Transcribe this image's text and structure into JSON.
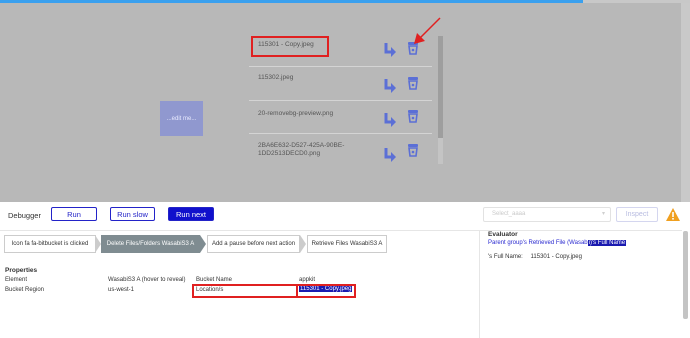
{
  "canvas": {
    "edit_button": "...edit me...",
    "files": [
      {
        "name": "115301 - Copy.jpeg"
      },
      {
        "name": "115302.jpeg"
      },
      {
        "name": "20-removebg-preview.png"
      },
      {
        "name": "2BA6E632-D527-425A-90BE-\n1DD2513DECD0.png"
      }
    ],
    "icons": {
      "move": "arrow-down-right-icon",
      "delete": "trash-icon",
      "warning": "warning-triangle-icon"
    },
    "colors": {
      "icon": "#5b6fd6",
      "highlight_box": "#e02020",
      "annotation_arrow": "#e02020"
    }
  },
  "debugger": {
    "label": "Debugger",
    "run": "Run",
    "run_slow": "Run slow",
    "run_next": "Run next",
    "select_placeholder": "Select_aaaa",
    "inspect": "Inspect",
    "steps": [
      {
        "label": "Icon fa fa-bitbucket is clicked"
      },
      {
        "label": "Delete Files/Folders WasabiS3 A"
      },
      {
        "label": "Add a pause before next action"
      },
      {
        "label": "Retrieve Files WasabiS3 A"
      }
    ]
  },
  "properties": {
    "title": "Properties",
    "rows": [
      {
        "name": "Element",
        "value": "WasabiS3 A (hover to reveal)",
        "name2": "Bucket Name",
        "value2": "appkit"
      },
      {
        "name": "Bucket Region",
        "value": "us-west-1",
        "name2": "Location/s",
        "value2": "115301 - Copy.jpeg"
      }
    ]
  },
  "evaluator": {
    "title": "Evaluator",
    "expression": "Parent group's Retrieved File (Wasab",
    "expression_hl": "i)'s Full Name",
    "result_label": "'s Full Name:",
    "result_value": "115301 - Copy.jpeg"
  }
}
